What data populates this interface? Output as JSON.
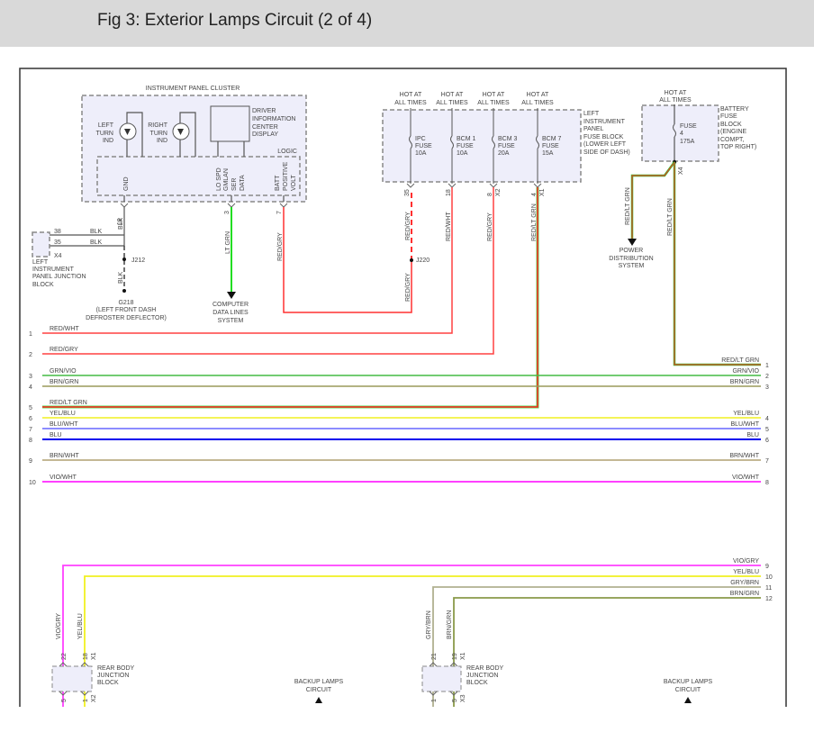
{
  "title": "Fig 3: Exterior Lamps Circuit (2 of 4)",
  "ipc": {
    "title": "INSTRUMENT PANEL CLUSTER",
    "left_turn": [
      "LEFT",
      "TURN",
      "IND"
    ],
    "right_turn": [
      "RIGHT",
      "TURN",
      "IND"
    ],
    "dic": [
      "DRIVER",
      "INFORMATION",
      "CENTER",
      "DISPLAY"
    ],
    "logic": "LOGIC",
    "gnd": "GND",
    "data": [
      "LO SPD",
      "GMLAN",
      "SER",
      "DATA"
    ],
    "batt": [
      "BATT",
      "POSITIVE",
      "VOLT"
    ],
    "pins": [
      "19",
      "3",
      "7"
    ]
  },
  "junction_left": {
    "pins": [
      "38",
      "35"
    ],
    "wire": "BLK",
    "connector": "X4",
    "name": [
      "LEFT",
      "INSTRUMENT",
      "PANEL JUNCTION",
      "BLOCK"
    ],
    "splice": "J212",
    "ground": "G218",
    "ground_desc": [
      "(LEFT FRONT DASH",
      "DEFROSTER DEFLECTOR)"
    ]
  },
  "cdl": {
    "wire": "LT GRN",
    "name": [
      "COMPUTER",
      "DATA LINES",
      "SYSTEM"
    ]
  },
  "fuse_block": {
    "hot": [
      "HOT AT",
      "ALL TIMES"
    ],
    "name": [
      "LEFT",
      "INSTRUMENT",
      "PANEL",
      "FUSE BLOCK",
      "(LOWER LEFT",
      "SIDE OF DASH)"
    ],
    "fuses": [
      {
        "l1": "IPC",
        "l2": "FUSE",
        "l3": "10A",
        "pin": "35",
        "conn": "",
        "wire": "RED/GRY"
      },
      {
        "l1": "BCM 1",
        "l2": "FUSE",
        "l3": "10A",
        "pin": "18",
        "conn": "",
        "wire": "RED/WHT"
      },
      {
        "l1": "BCM 3",
        "l2": "FUSE",
        "l3": "20A",
        "pin": "8",
        "conn": "X2",
        "wire": "RED/GRY"
      },
      {
        "l1": "BCM 7",
        "l2": "FUSE",
        "l3": "15A",
        "pin": "4",
        "conn": "X1",
        "wire": "RED/LT GRN"
      }
    ],
    "splice": "J220",
    "wire_below": "RED/GRY",
    "ipc_wire": "RED/GRY"
  },
  "battery_block": {
    "hot": [
      "HOT AT",
      "ALL TIMES"
    ],
    "fuse": [
      "FUSE",
      "4",
      "175A"
    ],
    "name": [
      "BATTERY",
      "FUSE",
      "BLOCK",
      "(ENGINE",
      "COMPT,",
      "TOP RIGHT)"
    ],
    "conn": "X4",
    "wire": "RED/LT GRN",
    "pds_wire": "RED/LT GRN",
    "pds": [
      "POWER",
      "DISTRIBUTION",
      "SYSTEM"
    ]
  },
  "left_wires": [
    {
      "n": "1",
      "label": "RED/WHT",
      "color": "#ff4040"
    },
    {
      "n": "2",
      "label": "RED/GRY",
      "color": "#ff5050"
    },
    {
      "n": "3",
      "label": "GRN/VIO",
      "color": "#44bb44"
    },
    {
      "n": "4",
      "label": "BRN/GRN",
      "color": "#9a9a5a"
    },
    {
      "n": "5",
      "label": "RED/LT GRN",
      "color": "#ff2020"
    },
    {
      "n": "6",
      "label": "YEL/BLU",
      "color": "#f0f020"
    },
    {
      "n": "7",
      "label": "BLU/WHT",
      "color": "#6666ff"
    },
    {
      "n": "8",
      "label": "BLU",
      "color": "#0000ee"
    },
    {
      "n": "9",
      "label": "BRN/WHT",
      "color": "#b0a070"
    },
    {
      "n": "10",
      "label": "VIO/WHT",
      "color": "#ff00ff"
    }
  ],
  "right_wires": [
    {
      "n": "1",
      "label": "RED/LT GRN"
    },
    {
      "n": "2",
      "label": "GRN/VIO"
    },
    {
      "n": "3",
      "label": "BRN/GRN"
    },
    {
      "n": "4",
      "label": "YEL/BLU"
    },
    {
      "n": "5",
      "label": "BLU/WHT"
    },
    {
      "n": "6",
      "label": "BLU"
    },
    {
      "n": "7",
      "label": "BRN/WHT"
    },
    {
      "n": "8",
      "label": "VIO/WHT"
    },
    {
      "n": "9",
      "label": "VIO/GRY",
      "color": "#ff40ff"
    },
    {
      "n": "10",
      "label": "YEL/BLU",
      "color": "#f0f020"
    },
    {
      "n": "11",
      "label": "GRY/BRN",
      "color": "#b0b090"
    },
    {
      "n": "12",
      "label": "BRN/GRN",
      "color": "#8a9a4a"
    }
  ],
  "rear_blocks": [
    {
      "name": [
        "REAR BODY",
        "JUNCTION",
        "BLOCK"
      ],
      "top_pins": [
        "22",
        "18"
      ],
      "top_conn": "X1",
      "bot_pins": [
        "5",
        "1"
      ],
      "bot_conn": "X2",
      "wires": [
        "VIO/GRY",
        "YEL/BLU"
      ]
    },
    {
      "name": [
        "REAR BODY",
        "JUNCTION",
        "BLOCK"
      ],
      "top_pins": [
        "21",
        "19"
      ],
      "top_conn": "X1",
      "bot_pins": [
        "1",
        "5"
      ],
      "bot_conn": "X3",
      "wires": [
        "GRY/BRN",
        "BRN/GRN"
      ]
    }
  ],
  "backup": [
    "BACKUP LAMPS",
    "CIRCUIT"
  ]
}
